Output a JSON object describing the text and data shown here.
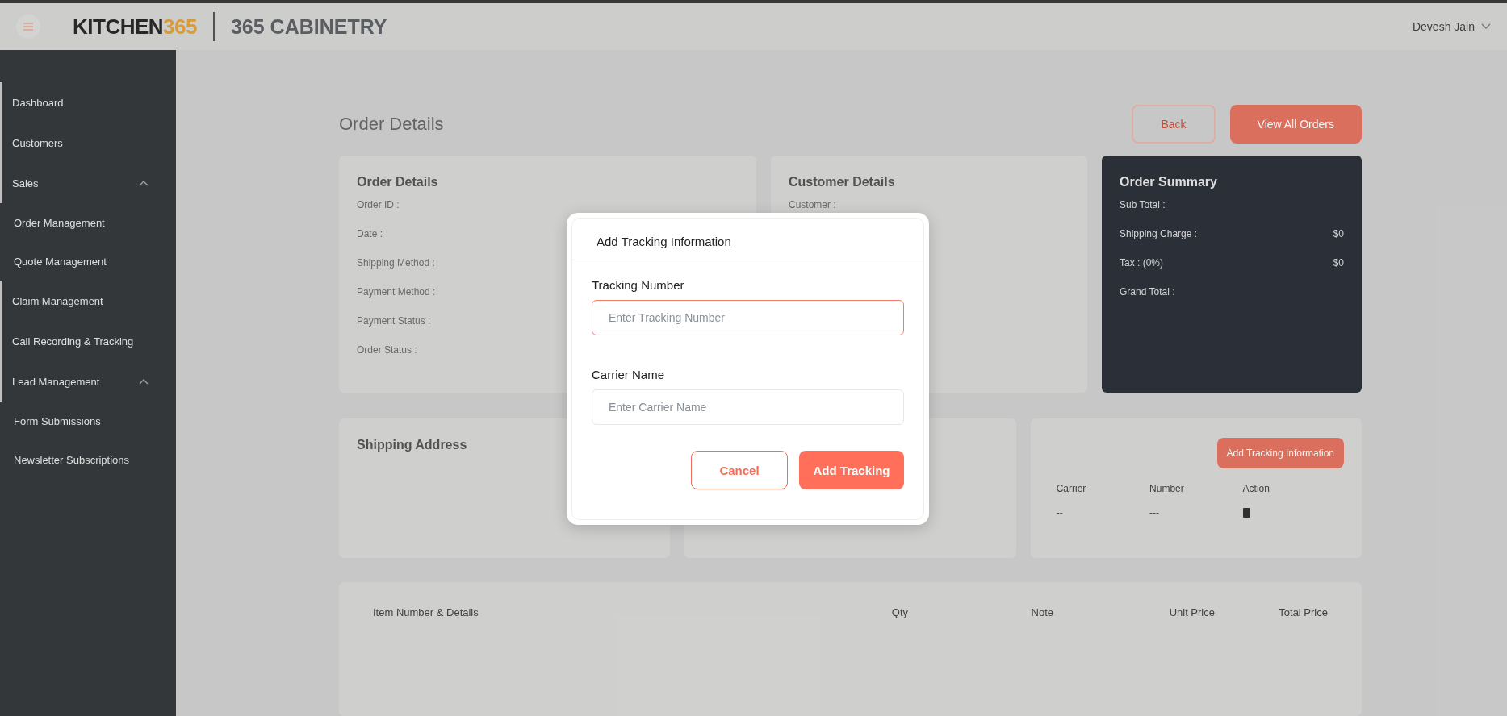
{
  "header": {
    "logo": {
      "main": "KITCHEN",
      "accent": "365"
    },
    "company": "365 CABINETRY",
    "user": "Devesh Jain"
  },
  "sidebar": {
    "items": [
      {
        "label": "Dashboard"
      },
      {
        "label": "Customers"
      },
      {
        "label": "Sales",
        "expanded": true,
        "children": [
          {
            "label": "Order Management"
          },
          {
            "label": "Quote Management"
          }
        ]
      },
      {
        "label": "Claim Management"
      },
      {
        "label": "Call Recording & Tracking"
      },
      {
        "label": "Lead Management",
        "expanded": true,
        "children": [
          {
            "label": "Form Submissions"
          },
          {
            "label": "Newsletter Subscriptions"
          }
        ]
      }
    ]
  },
  "page": {
    "title": "Order Details",
    "buttons": [
      {
        "label": "Back",
        "kind": "outline"
      },
      {
        "label": "View All Orders",
        "kind": "filled"
      }
    ]
  },
  "cards": [
    {
      "title": "Order Details",
      "kind": "light",
      "rows": [
        {
          "label": "Order ID :"
        },
        {
          "label": "Date :"
        },
        {
          "label": "Shipping Method :"
        },
        {
          "label": "Payment Method :"
        },
        {
          "label": "Payment Status :"
        },
        {
          "label": "Order Status :"
        }
      ]
    },
    {
      "title": "Customer Details",
      "kind": "light",
      "rows": [
        {
          "label": "Customer :"
        }
      ]
    },
    {
      "title": "Order Summary",
      "kind": "dark",
      "rows": [
        {
          "label": "Sub Total :"
        },
        {
          "label": "Shipping Charge :",
          "value": "$0"
        },
        {
          "label": "Tax : (0%)",
          "value": "$0"
        },
        {
          "label": "Grand Total :"
        }
      ]
    }
  ],
  "shipping_address": {
    "title": "Shipping Address"
  },
  "tracking_card": {
    "button": "Add Tracking Information",
    "columns": [
      "Carrier",
      "Number",
      "Action"
    ],
    "rows": [
      {
        "carrier": "--",
        "number": "---"
      }
    ]
  },
  "items_table": {
    "columns": [
      "Item Number & Details",
      "Qty",
      "Note",
      "Unit Price",
      "Total Price"
    ]
  },
  "dialog": {
    "title": "Add Tracking Information",
    "fields": [
      {
        "label": "Tracking Number",
        "placeholder": "Enter Tracking Number",
        "focused": true
      },
      {
        "label": "Carrier Name",
        "placeholder": "Enter Carrier Name",
        "focused": false
      }
    ],
    "buttons": [
      {
        "label": "Cancel",
        "kind": "outline"
      },
      {
        "label": "Add Tracking",
        "kind": "filled"
      }
    ]
  }
}
